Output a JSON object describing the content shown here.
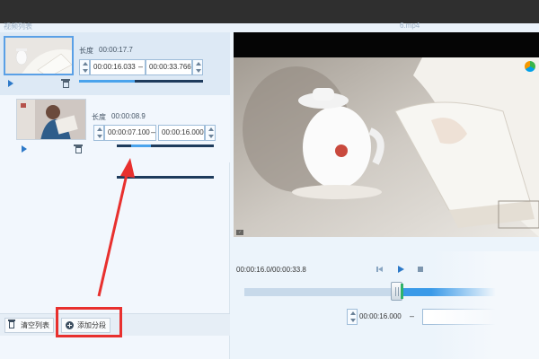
{
  "header": {
    "panel_title": "视频列表",
    "video_filename": "6.mp4"
  },
  "clips": [
    {
      "length_label": "长度",
      "length_value": "00:00:17.7",
      "start_time": "00:00:16.033",
      "end_time": "00:00:33.766",
      "progress": 0.45,
      "selected": true
    },
    {
      "length_label": "长度",
      "length_value": "00:00:08.9",
      "start_time": "00:00:07.100",
      "end_time": "00:00:16.000",
      "progress_start": 0.15,
      "progress_end": 0.35,
      "selected": false
    }
  ],
  "toolbar": {
    "clear_label": "清空列表",
    "add_segment_label": "添加分段"
  },
  "player": {
    "time_readout": "00:00:16.0/00:00:33.8",
    "segment_start": "00:00:16.000",
    "segment_dash": "–",
    "dash": "–",
    "selection_start_fraction": 0.53
  },
  "colors": {
    "accent": "#3a9ae8",
    "highlight": "#e8302e"
  },
  "icons": [
    "play-icon",
    "trash-icon",
    "add-icon",
    "clear-icon",
    "stop-icon",
    "previous-frame-icon",
    "spinner-icon"
  ]
}
